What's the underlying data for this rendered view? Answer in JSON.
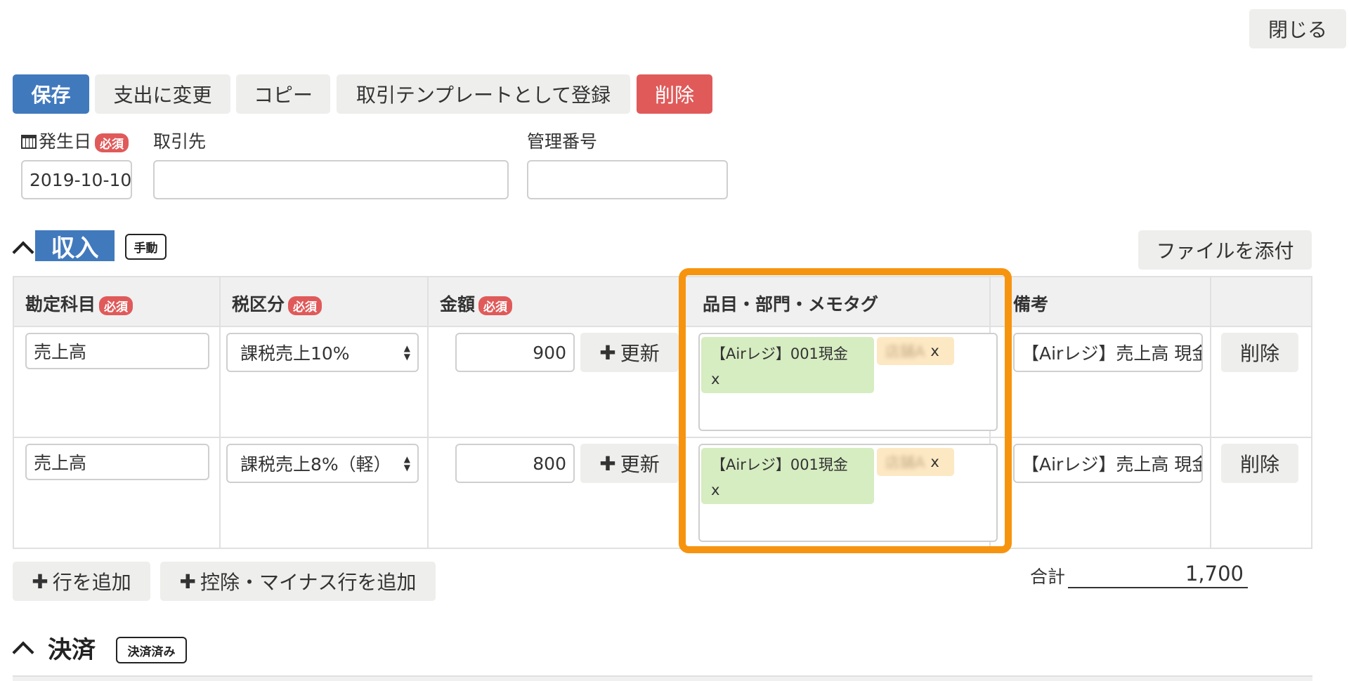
{
  "toolbar": {
    "close": "閉じる",
    "save": "保存",
    "change_to_expense": "支出に変更",
    "copy": "コピー",
    "register_template": "取引テンプレートとして登録",
    "delete": "削除"
  },
  "form": {
    "date_label": "発生日",
    "required": "必須",
    "date_value": "2019-10-10",
    "partner_label": "取引先",
    "partner_value": "",
    "control_number_label": "管理番号",
    "control_number_value": ""
  },
  "income_section": {
    "title": "収入",
    "mode_badge": "手動",
    "attach_file": "ファイルを添付",
    "columns": {
      "account": "勘定科目",
      "tax": "税区分",
      "amount": "金額",
      "tags": "品目・部門・メモタグ",
      "remarks": "備考"
    },
    "rows": [
      {
        "account": "売上高",
        "tax": "課税売上10%",
        "amount": "900",
        "update": "更新",
        "tag_item": "【Airレジ】001現金",
        "tag_item_remove": "x",
        "tag_dept": "店舗A",
        "tag_dept_remove": "x",
        "remarks": "【Airレジ】売上高 現金",
        "delete": "削除"
      },
      {
        "account": "売上高",
        "tax": "課税売上8%（軽）",
        "amount": "800",
        "update": "更新",
        "tag_item": "【Airレジ】001現金",
        "tag_item_remove": "x",
        "tag_dept": "店舗A",
        "tag_dept_remove": "x",
        "remarks": "【Airレジ】売上高 現金",
        "delete": "削除"
      }
    ],
    "add_row": "行を追加",
    "add_minus_row": "控除・マイナス行を追加",
    "total_label": "合計",
    "total_value": "1,700"
  },
  "settlement_section": {
    "title": "決済",
    "status_badge": "決済済み"
  },
  "highlight_color": "#f7940f",
  "colors": {
    "primary": "#4179bd",
    "danger": "#e05a5a",
    "tag_green": "#d6ecc1",
    "tag_orange": "#fde8c4"
  }
}
